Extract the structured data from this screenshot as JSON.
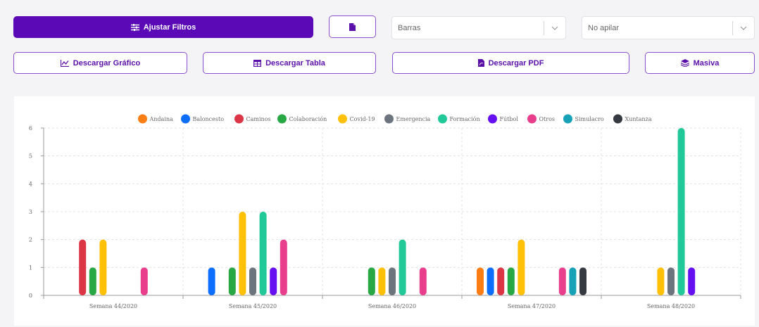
{
  "toolbar": {
    "filters_label": "Ajustar Filtros",
    "file_button_icon": "file-icon",
    "chart_type_select": {
      "value": "Barras"
    },
    "stack_select": {
      "value": "No apilar"
    },
    "download_chart_label": "Descargar Gráfico",
    "download_table_label": "Descargar Tabla",
    "download_pdf_label": "Descargar PDF",
    "bulk_label": "Masiva"
  },
  "colors": {
    "primary": "#5b08b6",
    "outline": "#8a4fd0"
  },
  "chart_data": {
    "type": "bar",
    "categories": [
      "Semana 44/2020",
      "Semana 45/2020",
      "Semana 46/2020",
      "Semana 47/2020",
      "Semana 48/2020"
    ],
    "ylim": [
      0,
      6
    ],
    "yticks": [
      0,
      1,
      2,
      3,
      4,
      5,
      6
    ],
    "grid": true,
    "legend_position": "top-center",
    "series": [
      {
        "name": "Andaina",
        "color": "#fd7e14",
        "values": [
          0,
          0,
          0,
          1,
          0
        ]
      },
      {
        "name": "Baloncesto",
        "color": "#0d6efd",
        "values": [
          0,
          1,
          0,
          1,
          0
        ]
      },
      {
        "name": "Caminos",
        "color": "#dc3545",
        "values": [
          2,
          0,
          0,
          1,
          0
        ]
      },
      {
        "name": "Colaboración",
        "color": "#28a745",
        "values": [
          1,
          1,
          1,
          1,
          0
        ]
      },
      {
        "name": "Covid-19",
        "color": "#ffc107",
        "values": [
          2,
          3,
          1,
          2,
          1
        ]
      },
      {
        "name": "Emergencia",
        "color": "#6c757d",
        "values": [
          0,
          1,
          1,
          0,
          1
        ]
      },
      {
        "name": "Formación",
        "color": "#20c997",
        "values": [
          0,
          3,
          2,
          0,
          6
        ]
      },
      {
        "name": "Fútbol",
        "color": "#6610f2",
        "values": [
          0,
          1,
          0,
          0,
          1
        ]
      },
      {
        "name": "Otros",
        "color": "#e83e8c",
        "values": [
          1,
          2,
          1,
          1,
          0
        ]
      },
      {
        "name": "Simulacro",
        "color": "#17a2b8",
        "values": [
          0,
          0,
          0,
          1,
          0
        ]
      },
      {
        "name": "Xuntanza",
        "color": "#343a40",
        "values": [
          0,
          0,
          0,
          1,
          0
        ]
      }
    ]
  }
}
